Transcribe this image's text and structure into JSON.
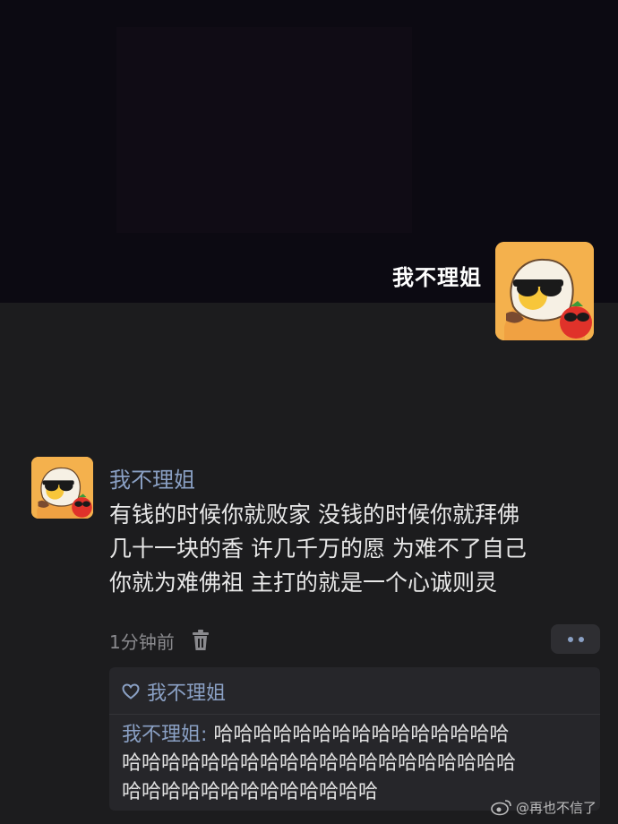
{
  "profile": {
    "name": "我不理姐"
  },
  "comment": {
    "author": "我不理姐",
    "lines": [
      "有钱的时候你就败家 没钱的时候你就拜佛",
      "几十一块的香 许几千万的愿 为难不了自己",
      "你就为难佛祖 主打的就是一个心诚则灵"
    ],
    "time": "1分钟前"
  },
  "reply_box": {
    "liked_by": "我不理姐",
    "reply_author": "我不理姐",
    "reply_separator": ": ",
    "reply_lines": [
      "哈哈哈哈哈哈哈哈哈哈哈哈哈哈哈",
      "哈哈哈哈哈哈哈哈哈哈哈哈哈哈哈哈哈哈哈哈",
      "哈哈哈哈哈哈哈哈哈哈哈哈哈"
    ]
  },
  "watermark": {
    "text": "@再也不信了"
  },
  "colors": {
    "background": "#1c1c1e",
    "top_area": "#0c0a12",
    "name_link": "#8aa0c4",
    "avatar_bg": "#f4b14d"
  },
  "icons": [
    "trash-icon",
    "heart-icon",
    "more-dots-icon",
    "weibo-icon"
  ]
}
